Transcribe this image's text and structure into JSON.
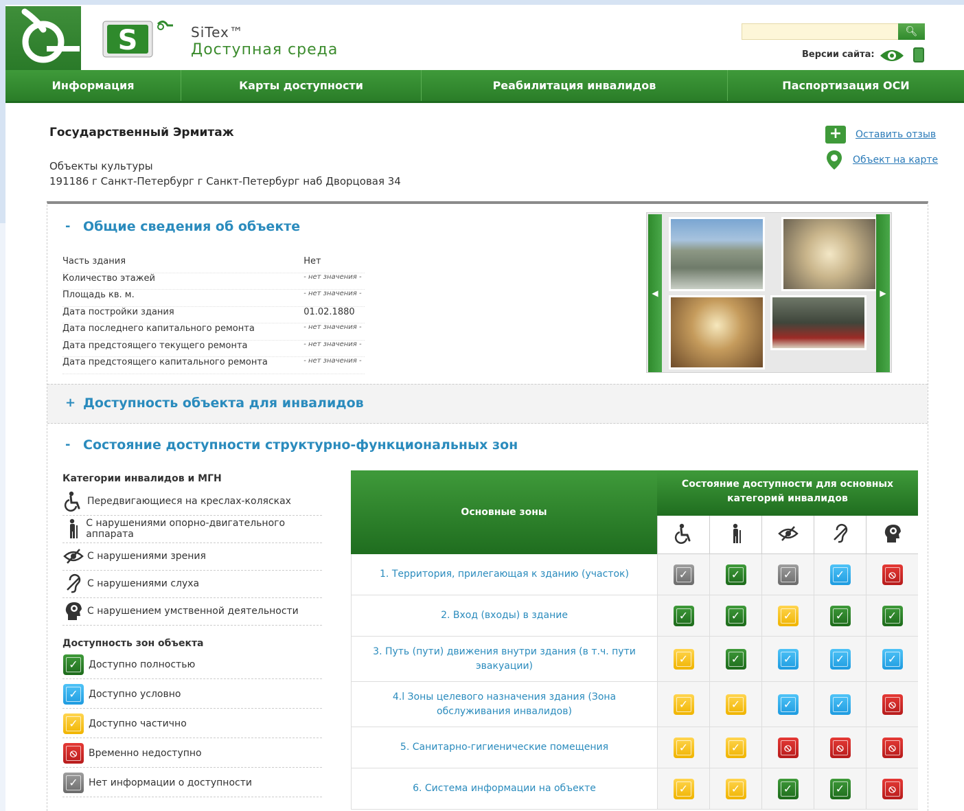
{
  "brand": {
    "name": "SiTex™",
    "subtitle": "Доступная среда"
  },
  "header": {
    "versions_label": "Версии сайта:"
  },
  "nav": [
    "Информация",
    "Карты доступности",
    "Реабилитация инвалидов",
    "Паспортизация ОСИ"
  ],
  "object": {
    "title": "Государственный Эрмитаж",
    "category": "Объекты культуры",
    "address": "191186 г Санкт-Петербург г Санкт-Петербург наб Дворцовая 34"
  },
  "actions": {
    "feedback": "Оставить отзыв",
    "map": "Объект на карте"
  },
  "sections": {
    "general": {
      "sign": "-",
      "title": "Общие сведения об объекте"
    },
    "accessibility": {
      "sign": "+",
      "title": "Доступность объекта для инвалидов"
    },
    "zones": {
      "sign": "-",
      "title": "Состояние доступности структурно-функциональных зон"
    }
  },
  "general_info": [
    {
      "key": "Часть здания",
      "value": "Нет"
    },
    {
      "key": "Количество этажей",
      "value": "- нет значения -"
    },
    {
      "key": "Площадь кв. м.",
      "value": "- нет значения -"
    },
    {
      "key": "Дата постройки здания",
      "value": "01.02.1880"
    },
    {
      "key": "Дата последнего капитального ремонта",
      "value": "- нет значения -"
    },
    {
      "key": "Дата предстоящего текущего ремонта",
      "value": "- нет значения -"
    },
    {
      "key": "Дата предстоящего капитального ремонта",
      "value": "- нет значения -"
    }
  ],
  "legend": {
    "categories_title": "Категории инвалидов и МГН",
    "categories": [
      {
        "icon": "wheelchair-icon",
        "label": "Передвигающиеся на креслах-колясках"
      },
      {
        "icon": "mobility-icon",
        "label": "С нарушениями опорно-двигательного аппарата"
      },
      {
        "icon": "vision-icon",
        "label": "С нарушениями зрения"
      },
      {
        "icon": "hearing-icon",
        "label": "С нарушениями слуха"
      },
      {
        "icon": "mental-icon",
        "label": "С нарушением умственной деятельности"
      }
    ],
    "access_title": "Доступность зон объекта",
    "access": [
      {
        "status": "full",
        "label": "Доступно полностью"
      },
      {
        "status": "cond",
        "label": "Доступно условно"
      },
      {
        "status": "part",
        "label": "Доступно частично"
      },
      {
        "status": "na",
        "label": "Временно недоступно"
      },
      {
        "status": "unk",
        "label": "Нет информации о доступности"
      }
    ]
  },
  "zones_table": {
    "col_zones": "Основные зоны",
    "col_status": "Состояние доступности для основных категорий инвалидов",
    "rows": [
      {
        "name": "1. Территория, прилегающая к зданию (участок)",
        "statuses": [
          "unk",
          "full",
          "unk",
          "cond",
          "na"
        ]
      },
      {
        "name": "2. Вход (входы) в здание",
        "statuses": [
          "full",
          "full",
          "part",
          "full",
          "full"
        ]
      },
      {
        "name": "3. Путь (пути) движения внутри здания (в т.ч. пути эвакуации)",
        "statuses": [
          "part",
          "full",
          "cond",
          "cond",
          "cond"
        ]
      },
      {
        "name": "4.l Зоны целевого назначения здания (Зона обслуживания инвалидов)",
        "statuses": [
          "part",
          "part",
          "cond",
          "cond",
          "na"
        ]
      },
      {
        "name": "5. Санитарно-гигиенические помещения",
        "statuses": [
          "part",
          "part",
          "na",
          "na",
          "na"
        ]
      },
      {
        "name": "6. Система информации на объекте",
        "statuses": [
          "part",
          "part",
          "full",
          "full",
          "na"
        ]
      }
    ]
  },
  "colors": {
    "brand_green": "#2f8a2c",
    "link_blue": "#2a8bbd"
  }
}
